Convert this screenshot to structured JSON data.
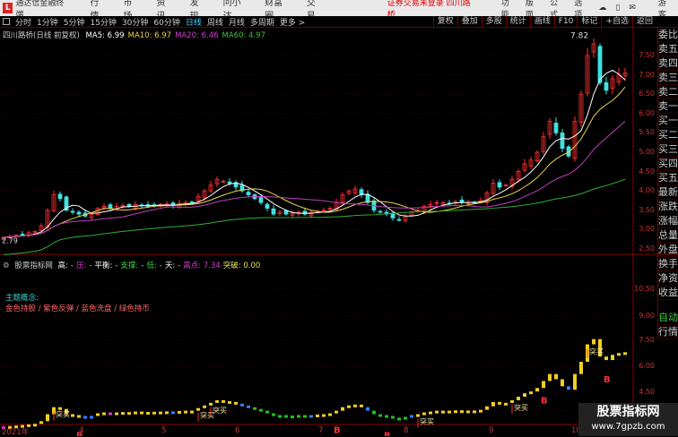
{
  "app": {
    "logo": "L",
    "title": "通达信金融终端",
    "menu": [
      "行情",
      "市场",
      "资讯",
      "发现",
      "问小达",
      "财富圈",
      "交易"
    ],
    "warning": "证券交易未登录 四川路桥",
    "right_menu": [
      "功能",
      "版面",
      "公式",
      "选项",
      "游客"
    ]
  },
  "toolbar": {
    "periods": [
      "分时",
      "1分钟",
      "5分钟",
      "15分钟",
      "30分钟",
      "60分钟",
      "日线",
      "周线",
      "月线",
      "多周期",
      "更多 >"
    ],
    "active": "日线",
    "right": [
      "复权",
      "叠加",
      "多股",
      "统计",
      "画线",
      "F10",
      "标记",
      "+自选",
      "返回"
    ]
  },
  "main": {
    "title": "四川路桥(日线 前复权)",
    "ma": [
      {
        "label": "MA5: 6.99",
        "color": "#ffffff"
      },
      {
        "label": "MA10: 6.97",
        "color": "#e8d44a"
      },
      {
        "label": "MA20: 6.46",
        "color": "#d040d0"
      },
      {
        "label": "MA60: 4.97",
        "color": "#40c040"
      }
    ],
    "high_label": "7.82",
    "low_label": "2.79",
    "axis": [
      "7.50",
      "7.00",
      "6.50",
      "6.00",
      "5.50",
      "5.00",
      "4.50",
      "4.00",
      "3.50",
      "3.00",
      "2.50"
    ],
    "closes": [
      2.8,
      2.82,
      2.85,
      2.88,
      2.92,
      2.95,
      3.1,
      3.5,
      3.9,
      3.8,
      3.5,
      3.45,
      3.4,
      3.35,
      3.4,
      3.55,
      3.6,
      3.55,
      3.6,
      3.62,
      3.6,
      3.65,
      3.63,
      3.6,
      3.64,
      3.65,
      3.66,
      3.62,
      3.68,
      3.7,
      3.7,
      3.85,
      4.0,
      4.15,
      4.3,
      4.25,
      4.2,
      4.1,
      4.0,
      3.9,
      3.8,
      3.7,
      3.55,
      3.4,
      3.45,
      3.4,
      3.42,
      3.45,
      3.4,
      3.45,
      3.48,
      3.5,
      3.55,
      3.7,
      3.9,
      4.0,
      4.05,
      3.9,
      3.7,
      3.5,
      3.45,
      3.4,
      3.3,
      3.25,
      3.35,
      3.45,
      3.5,
      3.6,
      3.65,
      3.7,
      3.7,
      3.68,
      3.72,
      3.7,
      3.71,
      3.7,
      3.75,
      3.95,
      4.2,
      4.1,
      4.15,
      4.3,
      4.5,
      4.7,
      4.8,
      5.0,
      5.4,
      5.8,
      5.5,
      5.1,
      4.9,
      5.8,
      6.5,
      7.5,
      7.8,
      6.8,
      6.6,
      6.9,
      7.0,
      7.05
    ]
  },
  "indicator": {
    "title": "股票指标网",
    "items": [
      {
        "label": "高:",
        "color": "#ffffff"
      },
      {
        "label": "-",
        "color": "#ccc"
      },
      {
        "label": "压:",
        "color": "#d040d0"
      },
      {
        "label": "-",
        "color": "#ccc"
      },
      {
        "label": "平衡:",
        "color": "#ffffff"
      },
      {
        "label": "-",
        "color": "#ccc"
      },
      {
        "label": "支撑:",
        "color": "#40d040"
      },
      {
        "label": "-",
        "color": "#ccc"
      },
      {
        "label": "低:",
        "color": "#40d040"
      },
      {
        "label": "-",
        "color": "#ccc"
      },
      {
        "label": "天:",
        "color": "#ffffff"
      },
      {
        "label": "-",
        "color": "#ccc"
      },
      {
        "label": "高点: 7.34",
        "color": "#d040d0"
      },
      {
        "label": "突破: 0.00",
        "color": "#e8e060"
      }
    ],
    "theme_title": "主题概念:",
    "theme_text": "金色持股 / 紫色反弹 / 蓝色洗盘 / 绿色持币",
    "axis": [
      "10.50",
      "9.00",
      "7.50",
      "6.00",
      "4.50"
    ],
    "signal_buy": "突买",
    "signal_b": "B",
    "buy_idx": [
      8,
      31,
      33,
      66,
      81,
      93
    ],
    "b_idx": [
      12,
      53,
      61,
      86,
      96
    ]
  },
  "dates": [
    "2021年",
    "4",
    "5",
    "6",
    "7",
    "8",
    "9",
    "10"
  ],
  "side": [
    "委比",
    "卖五",
    "卖四",
    "卖三",
    "卖二",
    "卖一",
    "买一",
    "买二",
    "买三",
    "买四",
    "买五",
    "最新",
    "涨跌",
    "涨幅",
    "总量",
    "外盘",
    "换手",
    "净资",
    "收益",
    "自动",
    "行情"
  ],
  "watermark": {
    "line1": "股票指标网",
    "line2": "www.7gpzb.com"
  },
  "colors": {
    "up": "#ff3030",
    "down": "#40e0e0",
    "grid": "#600000"
  }
}
